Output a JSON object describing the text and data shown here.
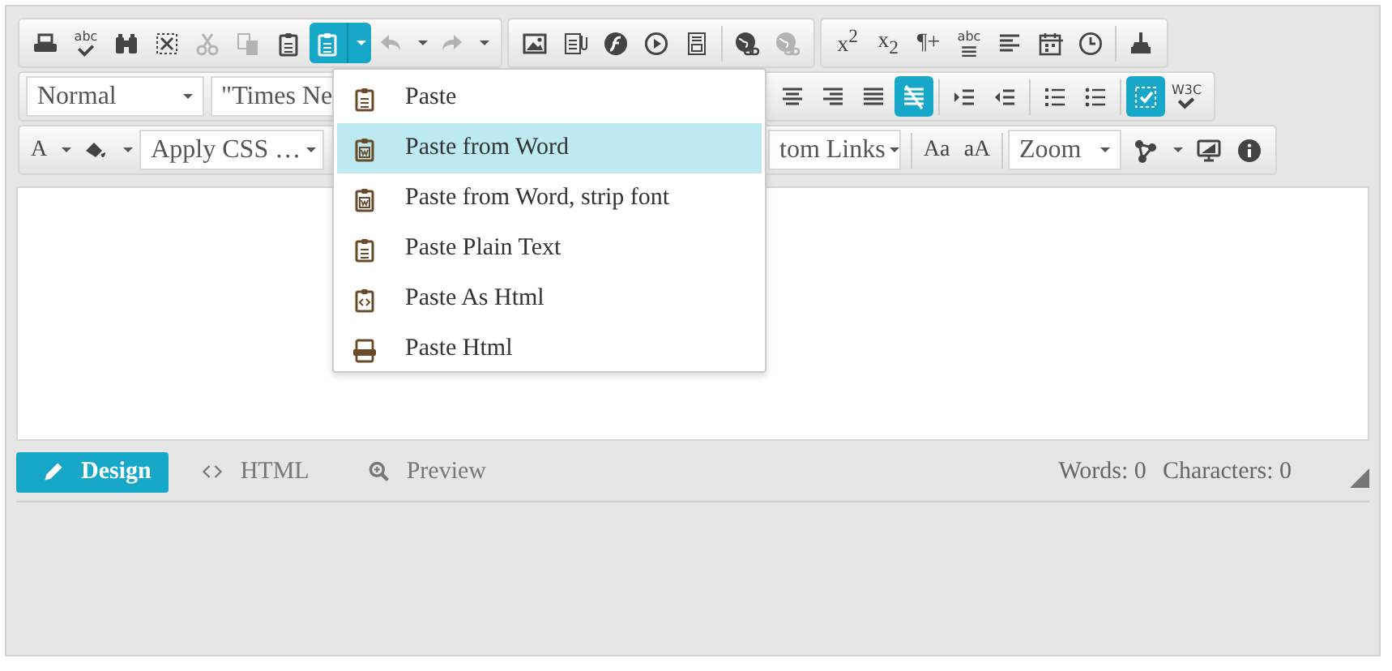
{
  "toolbars": [
    {
      "panels": [
        {
          "items": [
            {
              "kind": "icon",
              "active": false,
              "disabled": false
            },
            {
              "kind": "icon",
              "text": "abc",
              "active": false,
              "disabled": false
            },
            {
              "kind": "icon",
              "active": false,
              "disabled": false
            },
            {
              "kind": "icon",
              "active": false,
              "disabled": false
            },
            {
              "kind": "icon",
              "active": false,
              "disabled": true
            },
            {
              "kind": "icon",
              "active": false,
              "disabled": true
            },
            {
              "kind": "icon",
              "active": false,
              "disabled": false
            },
            {
              "kind": "icon",
              "active": true,
              "disabled": false
            },
            {
              "kind": "icon",
              "active": false,
              "disabled": true
            },
            {
              "kind": "icon",
              "active": false,
              "disabled": true
            }
          ]
        },
        {
          "items": [
            {
              "kind": "icon",
              "active": false,
              "disabled": false
            },
            {
              "kind": "icon",
              "active": false,
              "disabled": false
            },
            {
              "kind": "icon",
              "active": false,
              "disabled": false
            },
            {
              "kind": "icon",
              "active": false,
              "disabled": false
            },
            {
              "kind": "icon",
              "active": false,
              "disabled": false
            },
            {
              "kind": "sep"
            },
            {
              "kind": "icon",
              "active": false,
              "disabled": false
            },
            {
              "kind": "icon",
              "active": false,
              "disabled": true
            }
          ]
        },
        {
          "items": [
            {
              "kind": "text",
              "text": "x$^{2}$",
              "active": false,
              "disabled": false
            },
            {
              "kind": "text",
              "text": "x$_{2}$",
              "active": false,
              "disabled": false
            },
            {
              "kind": "text",
              "text": "¶+",
              "active": false,
              "disabled": false
            },
            {
              "kind": "icon",
              "text": "abc",
              "active": false,
              "disabled": false
            },
            {
              "kind": "icon",
              "active": false,
              "disabled": false
            },
            {
              "kind": "icon",
              "active": false,
              "disabled": false
            },
            {
              "kind": "icon",
              "active": false,
              "disabled": false
            },
            {
              "kind": "sep"
            },
            {
              "kind": "icon",
              "active": false,
              "disabled": false
            }
          ]
        }
      ]
    },
    {
      "panels": [
        {
          "items": [
            {
              "kind": "select",
              "value": "Normal"
            },
            {
              "kind": "select",
              "value": "\"Times Ne"
            }
          ]
        },
        {
          "items": [
            {
              "kind": "icon",
              "active": false,
              "disabled": false
            },
            {
              "kind": "icon",
              "active": false,
              "disabled": false
            },
            {
              "kind": "icon",
              "active": false,
              "disabled": false
            },
            {
              "kind": "icon",
              "active": true,
              "disabled": false
            },
            {
              "kind": "sep"
            },
            {
              "kind": "icon",
              "active": false,
              "disabled": false
            },
            {
              "kind": "icon",
              "active": false,
              "disabled": false
            },
            {
              "kind": "sep"
            },
            {
              "kind": "icon",
              "active": false,
              "disabled": false
            },
            {
              "kind": "icon",
              "active": false,
              "disabled": false
            },
            {
              "kind": "sep"
            },
            {
              "kind": "icon",
              "active": true,
              "disabled": false
            },
            {
              "kind": "icon",
              "text": "W3C",
              "active": false,
              "disabled": false
            }
          ]
        }
      ]
    },
    {
      "panels": [
        {
          "items": [
            {
              "kind": "text",
              "text": "A",
              "active": false,
              "disabled": false
            },
            {
              "kind": "icon",
              "active": false,
              "disabled": false
            },
            {
              "kind": "select",
              "value": "Apply CSS …"
            }
          ]
        },
        {
          "items": [
            {
              "kind": "select",
              "value": "tom Links"
            },
            {
              "kind": "sep"
            },
            {
              "kind": "text",
              "text": "Aa",
              "active": false,
              "disabled": false
            },
            {
              "kind": "text",
              "text": "aA",
              "active": false,
              "disabled": false
            },
            {
              "kind": "sep"
            },
            {
              "kind": "select",
              "value": "Zoom"
            },
            {
              "kind": "icon",
              "active": false,
              "disabled": false
            },
            {
              "kind": "icon",
              "active": false,
              "disabled": false
            },
            {
              "kind": "icon",
              "active": false,
              "disabled": false
            }
          ]
        }
      ]
    }
  ],
  "menu": {
    "items": [
      {
        "label": "Paste",
        "selected": false
      },
      {
        "label": "Paste from Word",
        "selected": true
      },
      {
        "label": "Paste from Word, strip font",
        "selected": false
      },
      {
        "label": "Paste Plain Text",
        "selected": false
      },
      {
        "label": "Paste As Html",
        "selected": false
      },
      {
        "label": "Paste Html",
        "selected": false
      }
    ]
  },
  "modes": [
    {
      "label": "Design",
      "selected": true
    },
    {
      "label": "HTML",
      "selected": false
    },
    {
      "label": "Preview",
      "selected": false
    }
  ],
  "counters": [
    "Words: 0",
    "Characters: 0"
  ]
}
